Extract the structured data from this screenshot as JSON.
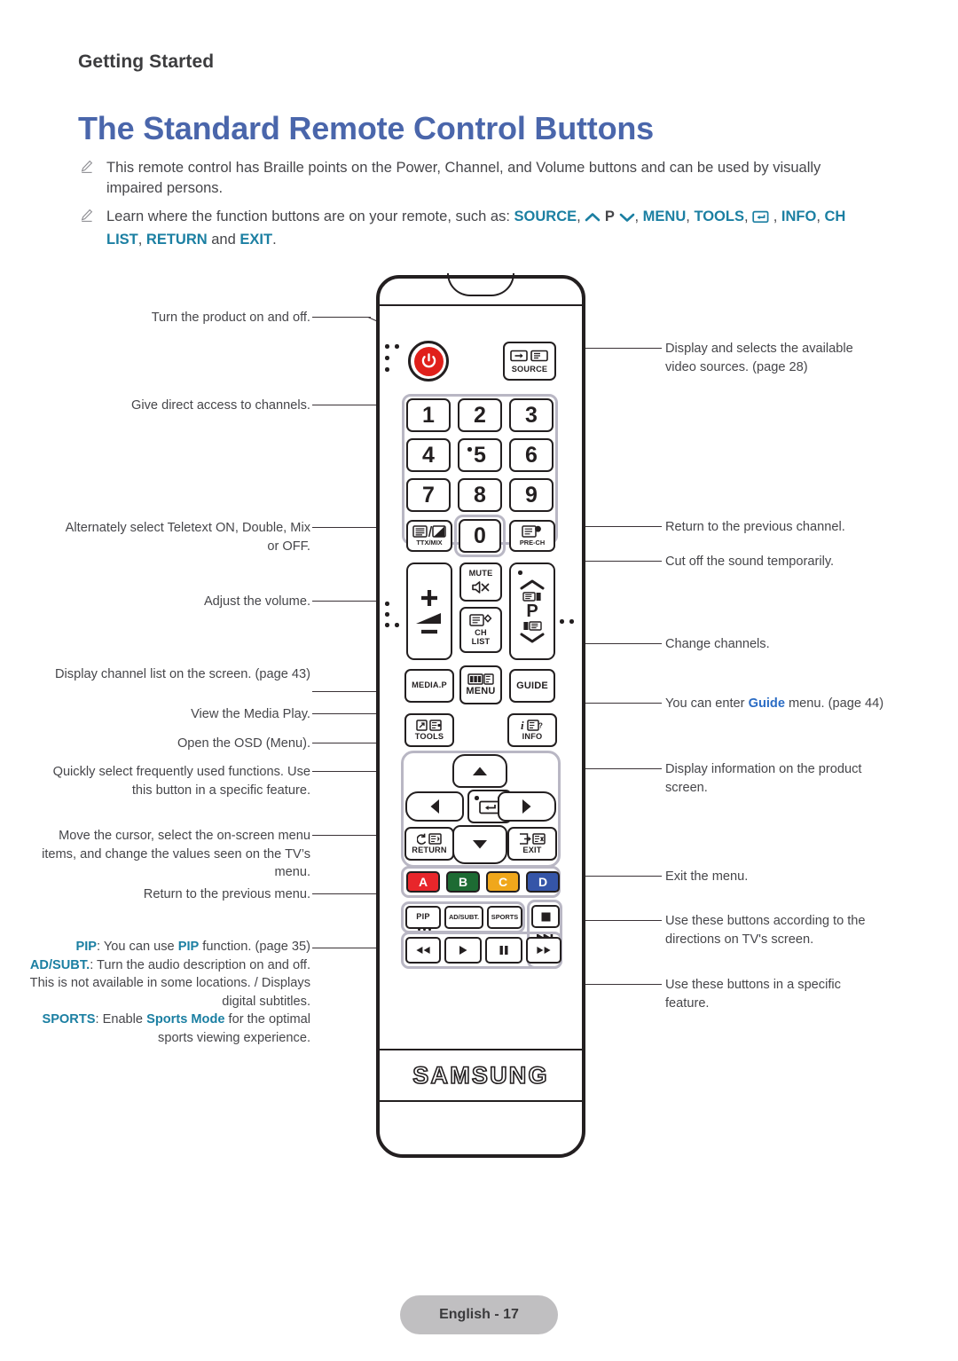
{
  "header": {
    "running_head": "Getting Started",
    "title": "The Standard Remote Control Buttons"
  },
  "notes": [
    {
      "icon": "pencil-note-icon",
      "text": "This remote control has Braille points on the Power, Channel, and Volume buttons and can be used by visually impaired persons."
    },
    {
      "icon": "pencil-note-icon",
      "lead": "Learn where the function buttons are on your remote, such as: ",
      "links": [
        "SOURCE",
        "P",
        "MENU",
        "TOOLS",
        "INFO",
        "CH LIST",
        "RETURN",
        "EXIT"
      ],
      "tail": "."
    }
  ],
  "callouts_left": [
    {
      "id": "power",
      "text": "Turn the product on and off."
    },
    {
      "id": "numeric",
      "text": "Give direct access to channels."
    },
    {
      "id": "ttxmix",
      "text": "Alternately select Teletext ON, Double, Mix or OFF."
    },
    {
      "id": "volume",
      "text": "Adjust the volume."
    },
    {
      "id": "chlist",
      "text": "Display channel list on the screen. (page 43)"
    },
    {
      "id": "mediap",
      "text": "View the Media Play."
    },
    {
      "id": "menu",
      "text": "Open the OSD (Menu)."
    },
    {
      "id": "tools",
      "text": "Quickly select frequently used functions. Use this button in a specific feature."
    },
    {
      "id": "dpad",
      "text": "Move the cursor, select the on-screen menu items, and change the values seen on the TV’s menu."
    },
    {
      "id": "return",
      "text": "Return to the previous menu."
    }
  ],
  "callout_pip": {
    "pip_label": "PIP",
    "pip_text_a": ": You can use ",
    "pip_link": "PIP",
    "pip_text_b": " function. (page 35)",
    "ad_label": "AD/SUBT.",
    "ad_text": ": Turn the audio description on and off. This is not available in some locations. / Displays digital subtitles.",
    "sports_label": "SPORTS",
    "sports_text_a": ": Enable ",
    "sports_link": "Sports Mode",
    "sports_text_b": " for the optimal sports viewing experience."
  },
  "callouts_right": [
    {
      "id": "source",
      "text": "Display and selects the available video sources. (page 28)"
    },
    {
      "id": "prech",
      "text": "Return to the previous channel."
    },
    {
      "id": "mute",
      "text": "Cut off the sound temporarily."
    },
    {
      "id": "channel",
      "text": "Change channels."
    },
    {
      "id": "guide",
      "pre": "You can enter ",
      "link": "Guide",
      "post": " menu. (page 44)"
    },
    {
      "id": "info",
      "text": "Display information on the product screen."
    },
    {
      "id": "exit",
      "text": "Exit the menu."
    },
    {
      "id": "abcd",
      "text": "Use these buttons according to the directions on TV's screen."
    },
    {
      "id": "media",
      "text": "Use these buttons in a specific feature."
    }
  ],
  "remote": {
    "brand": "SAMSUNG",
    "source_label": "SOURCE",
    "numbers": [
      "1",
      "2",
      "3",
      "4",
      "5",
      "6",
      "7",
      "8",
      "9",
      "0"
    ],
    "ttxmix_label": "TTX/MIX",
    "prech_label": "PRE-CH",
    "mute_label": "MUTE",
    "chlist_label_1": "CH",
    "chlist_label_2": "LIST",
    "p_label": "P",
    "mediap_label": "MEDIA.P",
    "menu_label": "MENU",
    "guide_label": "GUIDE",
    "tools_label": "TOOLS",
    "info_label": "INFO",
    "return_label": "RETURN",
    "exit_label": "EXIT",
    "color_keys": [
      {
        "label": "A",
        "color": "#e8262b"
      },
      {
        "label": "B",
        "color": "#1d6b33"
      },
      {
        "label": "C",
        "color": "#f0a71b"
      },
      {
        "label": "D",
        "color": "#3555a8"
      }
    ],
    "pip_label": "PIP",
    "adsubt_label": "AD/SUBT.",
    "sports_label": "SPORTS"
  },
  "footer": {
    "page_label": "English - 17"
  },
  "colors": {
    "title": "#4a66ab",
    "link_teal": "#1b7fa2",
    "link_blue": "#2b6cc4",
    "body_text": "#46464a",
    "outline": "#231f20",
    "plate": "#b9b7c4",
    "power_red": "#e0201b",
    "footer_pill": "#c0bfc1"
  }
}
